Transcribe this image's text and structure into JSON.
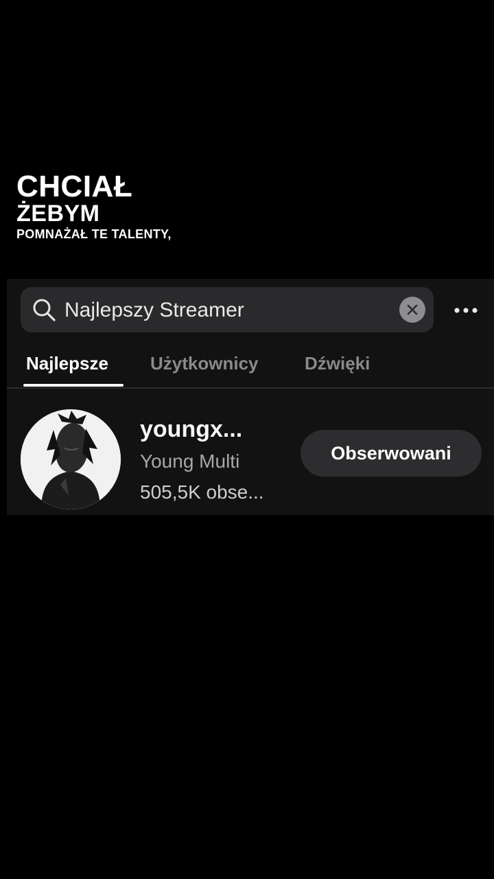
{
  "caption": {
    "line1": "CHCIAŁ",
    "line2": "ŻEBYM",
    "line3": "POMNAŻAŁ TE TALENTY,"
  },
  "search": {
    "query": "Najlepszy Streamer",
    "icon": "search-icon",
    "clear_icon": "close-icon",
    "more_icon": "more-horizontal-icon"
  },
  "tabs": [
    {
      "label": "Najlepsze",
      "active": true
    },
    {
      "label": "Użytkownicy",
      "active": false
    },
    {
      "label": "Dźwięki",
      "active": false
    }
  ],
  "result": {
    "username": "youngx...",
    "display_name": "Young Multi",
    "followers": "505,5K obse...",
    "follow_label": "Obserwowani"
  },
  "colors": {
    "background": "#000000",
    "panel": "#121212",
    "search_box": "#2a2a2c",
    "button": "#2d2d2f",
    "text_muted": "#8a8a8a"
  }
}
